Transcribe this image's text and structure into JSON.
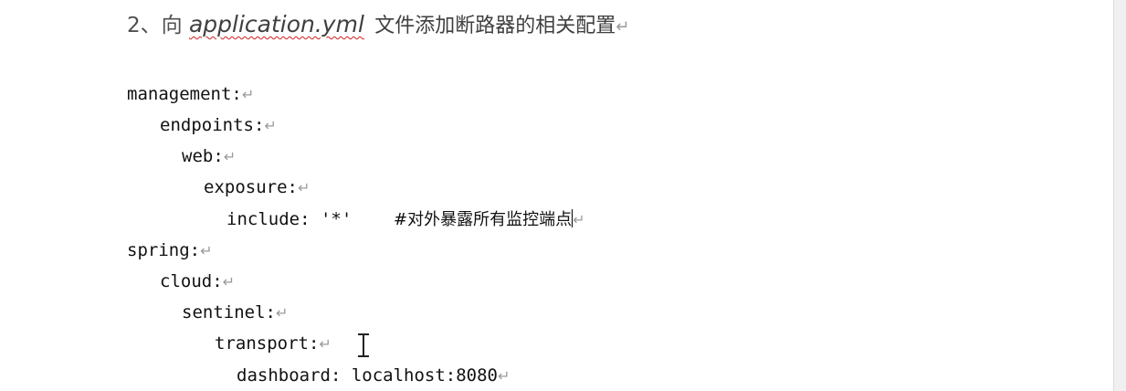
{
  "heading": {
    "number": "2、向",
    "filename": "application.yml",
    "text": "文件添加断路器的相关配置"
  },
  "paragraph_mark": "↵",
  "code": {
    "l1": "management:",
    "l2": "endpoints:",
    "l3": "web:",
    "l4": "exposure:",
    "l5": "include: '*'    ",
    "l5_comment": "#对外暴露所有监控端点",
    "l6": "spring:",
    "l7": "cloud:",
    "l8": "sentinel:",
    "l9": "transport:",
    "l10": "dashboard: localhost:8080"
  }
}
